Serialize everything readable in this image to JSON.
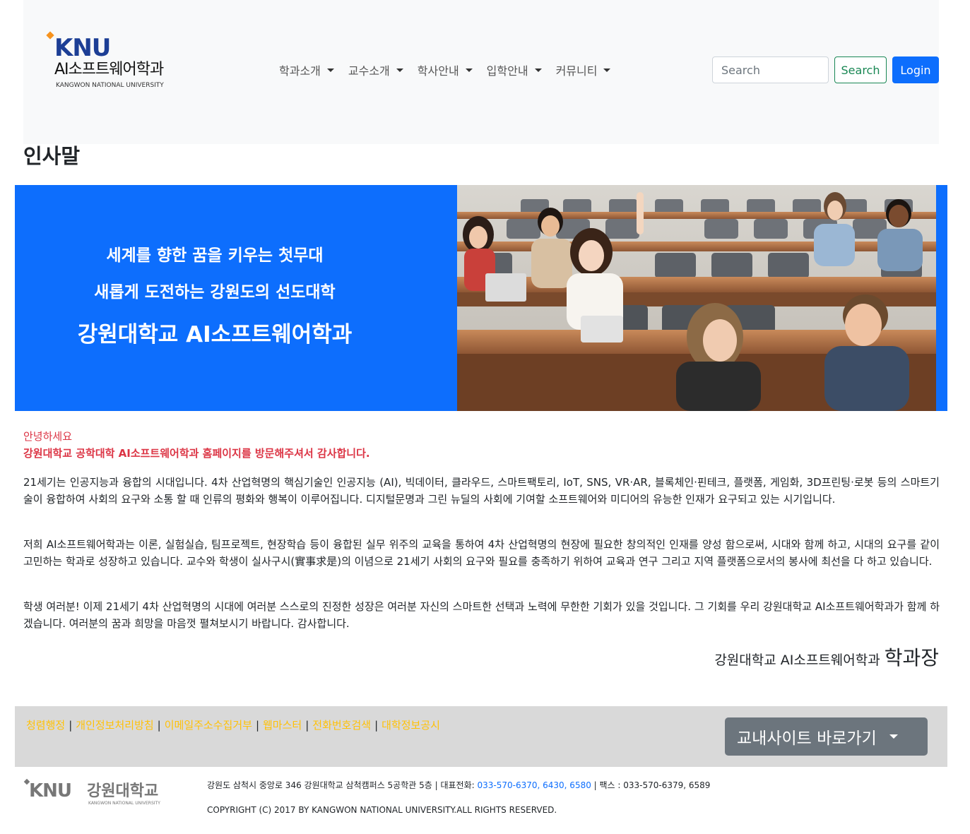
{
  "header": {
    "logo_mark": "KNU",
    "logo_dept": "AI소프트웨어학과",
    "logo_university": "KANGWON NATIONAL UNIVERSITY",
    "nav": [
      {
        "label": "학과소개"
      },
      {
        "label": "교수소개"
      },
      {
        "label": "학사안내"
      },
      {
        "label": "입학안내"
      },
      {
        "label": "커뮤니티"
      }
    ],
    "search_placeholder": "Search",
    "search_button": "Search",
    "login_button": "Login"
  },
  "page_title": "인사말",
  "banner": {
    "line1": "세계를 향한 꿈을 키우는 첫무대",
    "line2": "새롭게 도전하는 강원도의 선도대학",
    "line3": "강원대학교 AI소프트웨어학과"
  },
  "greeting": {
    "hello": "안녕하세요",
    "thanks": "강원대학교 공학대학 AI소프트웨어학과 홈페이지를 방문해주셔서 감사합니다."
  },
  "paragraphs": [
    "21세기는 인공지능과 융합의 시대입니다. 4차 산업혁명의 핵심기술인 인공지능 (AI), 빅데이터, 클라우드, 스마트팩토리, IoT, SNS, VR·AR, 블록체인·핀테크, 플랫폼, 게임화, 3D프린팅·로봇 등의 스마트기술이 융합하여 사회의 요구와 소통 할 때 인류의 평화와 행복이 이루어집니다. 디지털문명과 그린 뉴딜의 사회에 기여할 소프트웨어와 미디어의 유능한 인재가 요구되고 있는 시기입니다.",
    "저희 AI소프트웨어학과는 이론, 실험실습, 팀프로젝트, 현장학습 등이 융합된 실무 위주의 교육을 통하여 4차 산업혁명의 현장에 필요한 창의적인 인재를 양성 함으로써, 시대와 함께 하고, 시대의 요구를 같이 고민하는 학과로 성장하고 있습니다. 교수와 학생이 실사구시(實事求是)의 이념으로 21세기 사회의 요구와 필요를 충족하기 위하여 교육과 연구 그리고 지역 플랫폼으로서의 봉사에 최선을 다 하고 있습니다.",
    "학생 여러분! 이제 21세기 4차 산업혁명의 시대에 여러분 스스로의 진정한 성장은 여러분 자신의 스마트한 선택과 노력에 무한한 기회가 있을 것입니다. 그 기회를 우리 강원대학교 AI소프트웨어학과가 함께 하겠습니다. 여러분의 꿈과 희망을 마음껏 펼쳐보시기 바랍니다. 감사합니다."
  ],
  "signature": {
    "dept": "강원대학교 AI소프트웨어학과",
    "title": "학과장"
  },
  "footer": {
    "links": [
      {
        "label": "청렴행정"
      },
      {
        "label": "개인정보처리방침"
      },
      {
        "label": "이메일주소수집거부"
      },
      {
        "label": "웹마스터"
      },
      {
        "label": "전화번호검색"
      },
      {
        "label": "대학정보공시"
      }
    ],
    "site_button": "교내사이트 바로가기",
    "logo_mark": "KNU",
    "logo_kr": "강원대학교",
    "logo_en": "KANGWON NATIONAL UNIVERSITY",
    "address": "강원도 삼척시 중앙로 346 강원대학교 삼척캠퍼스 5공학관 5층 | 대표전화: ",
    "phone": "033-570-6370, 6430, 6580",
    "fax": " | 팩스 : 033-570-6379, 6589",
    "copyright": "COPYRIGHT (C) 2017 BY KANGWON NATIONAL UNIVERSITY.ALL RIGHTS RESERVED."
  },
  "colors": {
    "primary": "#0d6efd",
    "success": "#198754",
    "danger": "#dc3545",
    "warning": "#ffc107",
    "secondary": "#6c757d"
  }
}
